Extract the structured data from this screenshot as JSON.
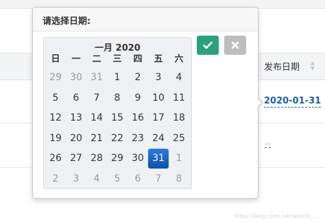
{
  "table": {
    "column_header": "发布日期",
    "sort_icon": "sort-icon",
    "row1_date": "2020-01-31",
    "row2_empty": "--"
  },
  "popover": {
    "title": "请选择日期:"
  },
  "calendar": {
    "month_label": "一月 2020",
    "weekdays": [
      "日",
      "一",
      "二",
      "三",
      "四",
      "五",
      "六"
    ],
    "weeks": [
      [
        "29",
        "30",
        "31",
        "1",
        "2",
        "3",
        "4"
      ],
      [
        "5",
        "6",
        "7",
        "8",
        "9",
        "10",
        "11"
      ],
      [
        "12",
        "13",
        "14",
        "15",
        "16",
        "17",
        "18"
      ],
      [
        "19",
        "20",
        "21",
        "22",
        "23",
        "24",
        "25"
      ],
      [
        "26",
        "27",
        "28",
        "29",
        "30",
        "31",
        "1"
      ],
      [
        "2",
        "3",
        "4",
        "5",
        "6",
        "7",
        "8"
      ]
    ],
    "selected_day": "31",
    "accent_color": "#1560c0"
  },
  "buttons": {
    "ok_icon": "check-icon",
    "cancel_icon": "close-icon",
    "ok_color": "#2aa27a",
    "cancel_color": "#bdbdbd"
  },
  "watermark": "https://blog.csdn.net/weixin_..."
}
